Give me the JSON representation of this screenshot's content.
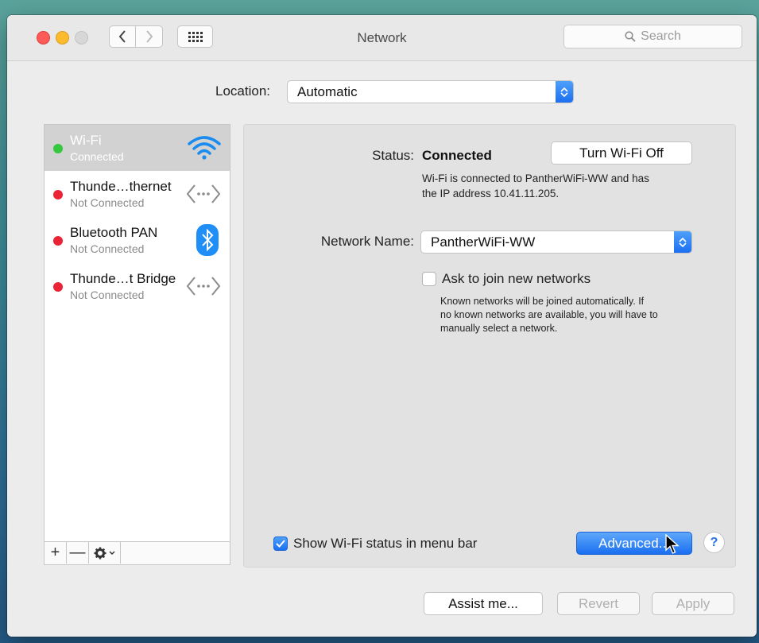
{
  "window": {
    "title": "Network",
    "search_placeholder": "Search"
  },
  "location": {
    "label": "Location:",
    "value": "Automatic"
  },
  "services": [
    {
      "name": "Wi-Fi",
      "status": "Connected",
      "status_color": "#35c83e",
      "icon": "wifi-icon",
      "selected": true
    },
    {
      "name": "Thunde…thernet",
      "status": "Not Connected",
      "status_color": "#ea2434",
      "icon": "ethernet-icon",
      "selected": false
    },
    {
      "name": "Bluetooth PAN",
      "status": "Not Connected",
      "status_color": "#ea2434",
      "icon": "bluetooth-icon",
      "selected": false
    },
    {
      "name": "Thunde…t Bridge",
      "status": "Not Connected",
      "status_color": "#ea2434",
      "icon": "ethernet-icon",
      "selected": false
    }
  ],
  "sidebar_bar": {
    "add": "+",
    "remove": "—"
  },
  "detail": {
    "status_label": "Status:",
    "status_value": "Connected",
    "toggle_button": "Turn Wi-Fi Off",
    "status_desc_line1": "Wi-Fi is connected to PantherWiFi-WW and has",
    "status_desc_line2": "the IP address 10.41.11.205.",
    "network_name_label": "Network Name:",
    "network_name_value": "PantherWiFi-WW",
    "ask_join_label": "Ask to join new networks",
    "ask_join_checked": false,
    "ask_join_desc_line1": "Known networks will be joined automatically. If",
    "ask_join_desc_line2": "no known networks are available, you will have to",
    "ask_join_desc_line3": "manually select a network.",
    "show_status_label": "Show Wi-Fi status in menu bar",
    "show_status_checked": true,
    "advanced_button": "Advanced...",
    "help": "?"
  },
  "footer": {
    "assist": "Assist me...",
    "revert": "Revert",
    "apply": "Apply"
  },
  "colors": {
    "accent": "#1a6ff0",
    "connected": "#35c83e",
    "not_connected": "#ea2434"
  }
}
